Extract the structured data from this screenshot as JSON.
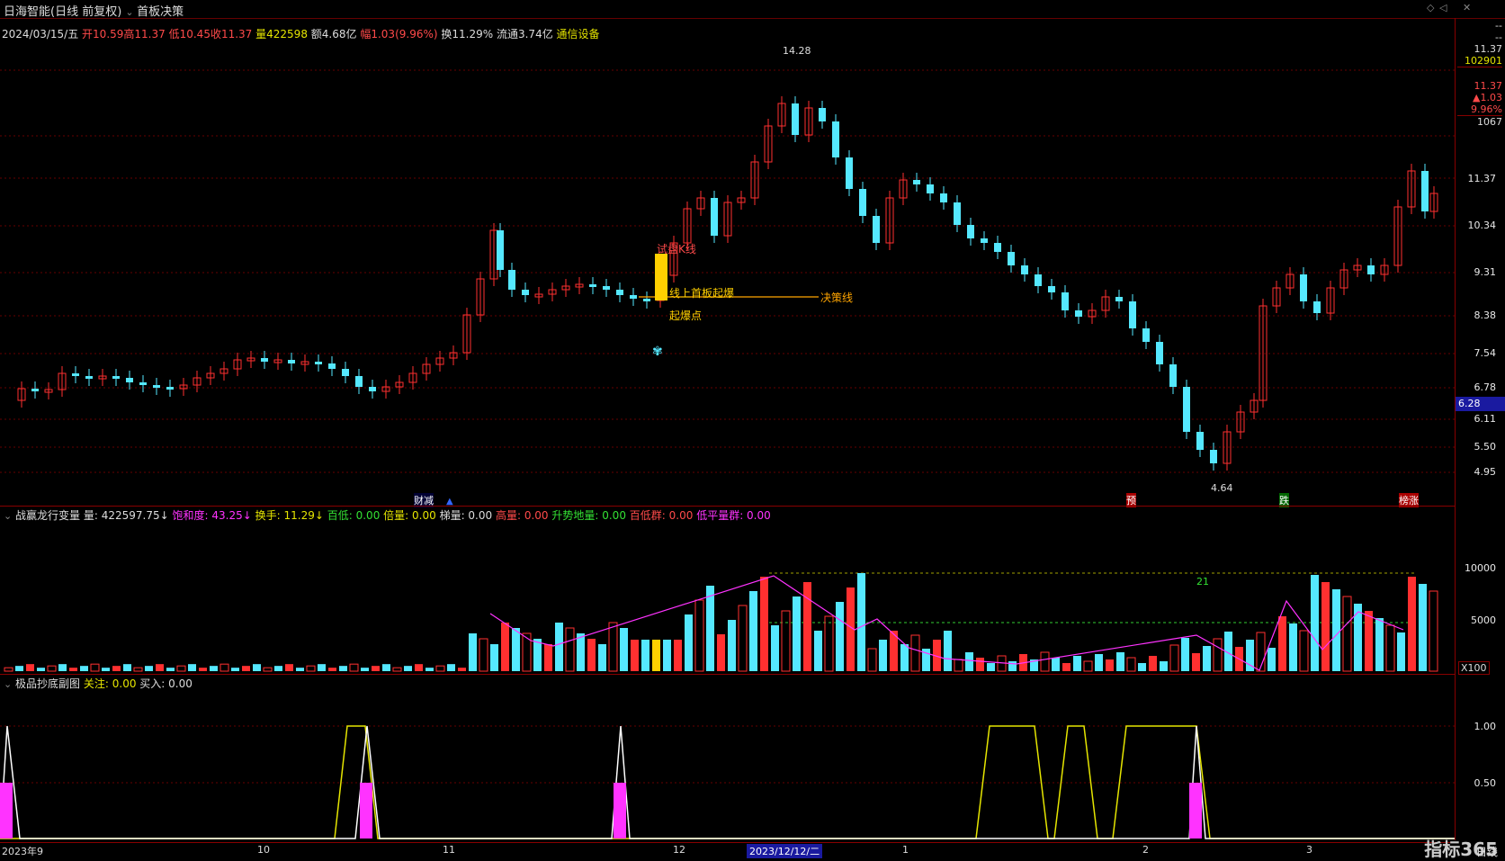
{
  "window": {
    "title": "日海智能(日线 前复权)",
    "tab": "首板决策"
  },
  "quote": {
    "date": "2024/03/15/五",
    "open": "开10.59",
    "high": "高11.37",
    "low": "低10.45",
    "close": "收11.37",
    "volume": "量422598",
    "amount": "额4.68亿",
    "change": "幅1.03(9.96%)",
    "turnover": "换11.29%",
    "float": "流通3.74亿",
    "sector": "通信设备"
  },
  "right_panel": {
    "price": "11.37",
    "vol": "102901",
    "price2": "11.37",
    "change": "▲1.03",
    "pct": "9.96%",
    "vol2": "1067"
  },
  "price_axis": [
    "11.37",
    "10.34",
    "9.31",
    "8.38",
    "7.54",
    "6.78",
    "6.11",
    "5.50",
    "4.95"
  ],
  "price_marker": "6.28",
  "annotations": {
    "high": "14.28",
    "low": "4.64",
    "test_line": "试盘K线",
    "first_board": "线上首板起爆",
    "decision_line": "决策线",
    "launch_point": "起爆点",
    "tag1": "财减",
    "tag2": "预",
    "tag3": "跌",
    "tag4": "榜涨"
  },
  "indicator1": {
    "name": "战赢龙行变量",
    "vol": "量: 422597.75↓",
    "sat": "饱和度: 43.25↓",
    "turn": "换手: 11.29↓",
    "bailow": "百低: 0.00",
    "double": "倍量: 0.00",
    "ladder": "梯量: 0.00",
    "highvol": "高量: 0.00",
    "rise": "升势地量: 0.00",
    "lowgroup": "百低群: 0.00",
    "flat": "低平量群: 0.00",
    "axis": [
      "10000",
      "5000"
    ],
    "unit": "X100",
    "note21": "21"
  },
  "indicator2": {
    "name": "极品抄底副图",
    "focus": "关注: 0.00",
    "buy": "买入: 0.00",
    "axis": [
      "1.00",
      "0.50"
    ]
  },
  "date_axis": [
    "2023年9",
    "10",
    "11",
    "12",
    "2023/12/12/二",
    "1",
    "2",
    "3"
  ],
  "bottom": {
    "logo": "指标365",
    "period": "日线"
  },
  "colors": {
    "up": "#ff3030",
    "down": "#55e8ff",
    "bg": "#000000",
    "grid": "#800000"
  }
}
